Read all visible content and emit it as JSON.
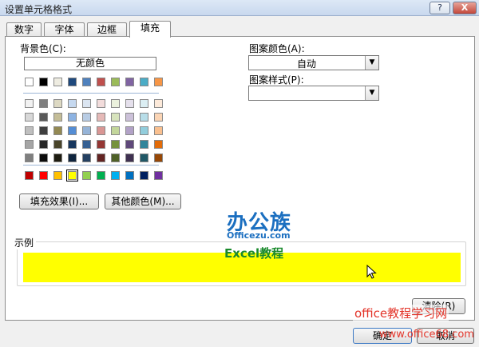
{
  "window": {
    "title": "设置单元格格式",
    "help_label": "?",
    "close_label": "X"
  },
  "tabs": [
    {
      "label": "数字"
    },
    {
      "label": "字体"
    },
    {
      "label": "边框"
    },
    {
      "label": "填充"
    }
  ],
  "fill": {
    "background_label": "背景色(C):",
    "no_color_label": "无颜色",
    "theme_top_row": [
      "#ffffff",
      "#000000",
      "#eeece1",
      "#1f497d",
      "#4f81bd",
      "#c0504d",
      "#9bbb59",
      "#8064a2",
      "#4bacc6",
      "#f79646"
    ],
    "theme_tints": [
      [
        "#f2f2f2",
        "#7f7f7f",
        "#ddd9c3",
        "#c6d9f0",
        "#dbe5f1",
        "#f2dcdb",
        "#ebf1dd",
        "#e5e0ec",
        "#dbeef3",
        "#fdeada"
      ],
      [
        "#d8d8d8",
        "#595959",
        "#c4bd97",
        "#8db3e2",
        "#b8cce4",
        "#e5b9b7",
        "#d7e3bc",
        "#ccc1d9",
        "#b7dde8",
        "#fbd5b5"
      ],
      [
        "#bfbfbf",
        "#3f3f3f",
        "#938953",
        "#548dd4",
        "#95b3d7",
        "#d99694",
        "#c3d69b",
        "#b2a2c7",
        "#92cddc",
        "#fac08f"
      ],
      [
        "#a5a5a5",
        "#262626",
        "#494429",
        "#17365d",
        "#366092",
        "#953734",
        "#76923c",
        "#5f497a",
        "#31859b",
        "#e36c09"
      ],
      [
        "#7f7f7f",
        "#0c0c0c",
        "#1d1b10",
        "#0f243e",
        "#244061",
        "#632423",
        "#4f6128",
        "#3f3151",
        "#205867",
        "#974806"
      ]
    ],
    "standard_colors": [
      "#c00000",
      "#ff0000",
      "#ffc000",
      "#ffff00",
      "#92d050",
      "#00b050",
      "#00b0f0",
      "#0070c0",
      "#002060",
      "#7030a0"
    ],
    "selected_standard_index": 3,
    "fill_effects_label": "填充效果(I)...",
    "more_colors_label": "其他颜色(M)...",
    "pattern_color_label": "图案颜色(A):",
    "pattern_color_value": "自动",
    "pattern_style_label": "图案样式(P):",
    "pattern_style_value": "",
    "sample_label": "示例",
    "sample_color": "#ffff00"
  },
  "watermark": {
    "logo_text": "办公族",
    "site_text": "Officezu.com",
    "course_text": "Excel教程",
    "brand_text": "office教程学习网",
    "url_text": "www.office68.com"
  },
  "buttons": {
    "clear_label": "清除(R)",
    "ok_label": "确定",
    "cancel_label": "取消"
  }
}
